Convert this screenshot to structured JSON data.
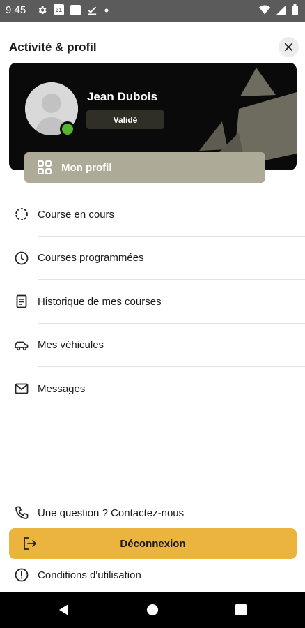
{
  "status_bar": {
    "time": "9:45",
    "calendar_day": "31",
    "icons": [
      "gear-icon",
      "calendar-icon",
      "square-icon",
      "check-download-icon",
      "dot-icon",
      "wifi-icon",
      "signal-icon",
      "battery-icon"
    ]
  },
  "header": {
    "title": "Activité & profil",
    "close_icon": "close-icon"
  },
  "profile": {
    "name": "Jean Dubois",
    "status_badge": "Validé",
    "online_color": "#55b52e",
    "card_color": "#0a0a0a"
  },
  "profile_button": {
    "label": "Mon profil",
    "icon": "grid-icon",
    "color": "#aeaa98"
  },
  "menu": {
    "items": [
      {
        "label": "Course en cours",
        "icon": "loading-circle-icon"
      },
      {
        "label": "Courses programmées",
        "icon": "clock-icon"
      },
      {
        "label": "Historique de mes courses",
        "icon": "document-icon"
      },
      {
        "label": "Mes véhicules",
        "icon": "car-icon"
      },
      {
        "label": "Messages",
        "icon": "mail-icon"
      }
    ]
  },
  "footer": {
    "contact_label": "Une question ? Contactez-nous",
    "logout_label": "Déconnexion",
    "logout_color": "#ebb43f",
    "conditions_label": "Conditions d'utilisation"
  },
  "navigation_bar": {
    "icons": [
      "back-icon",
      "home-icon",
      "recents-icon"
    ]
  }
}
